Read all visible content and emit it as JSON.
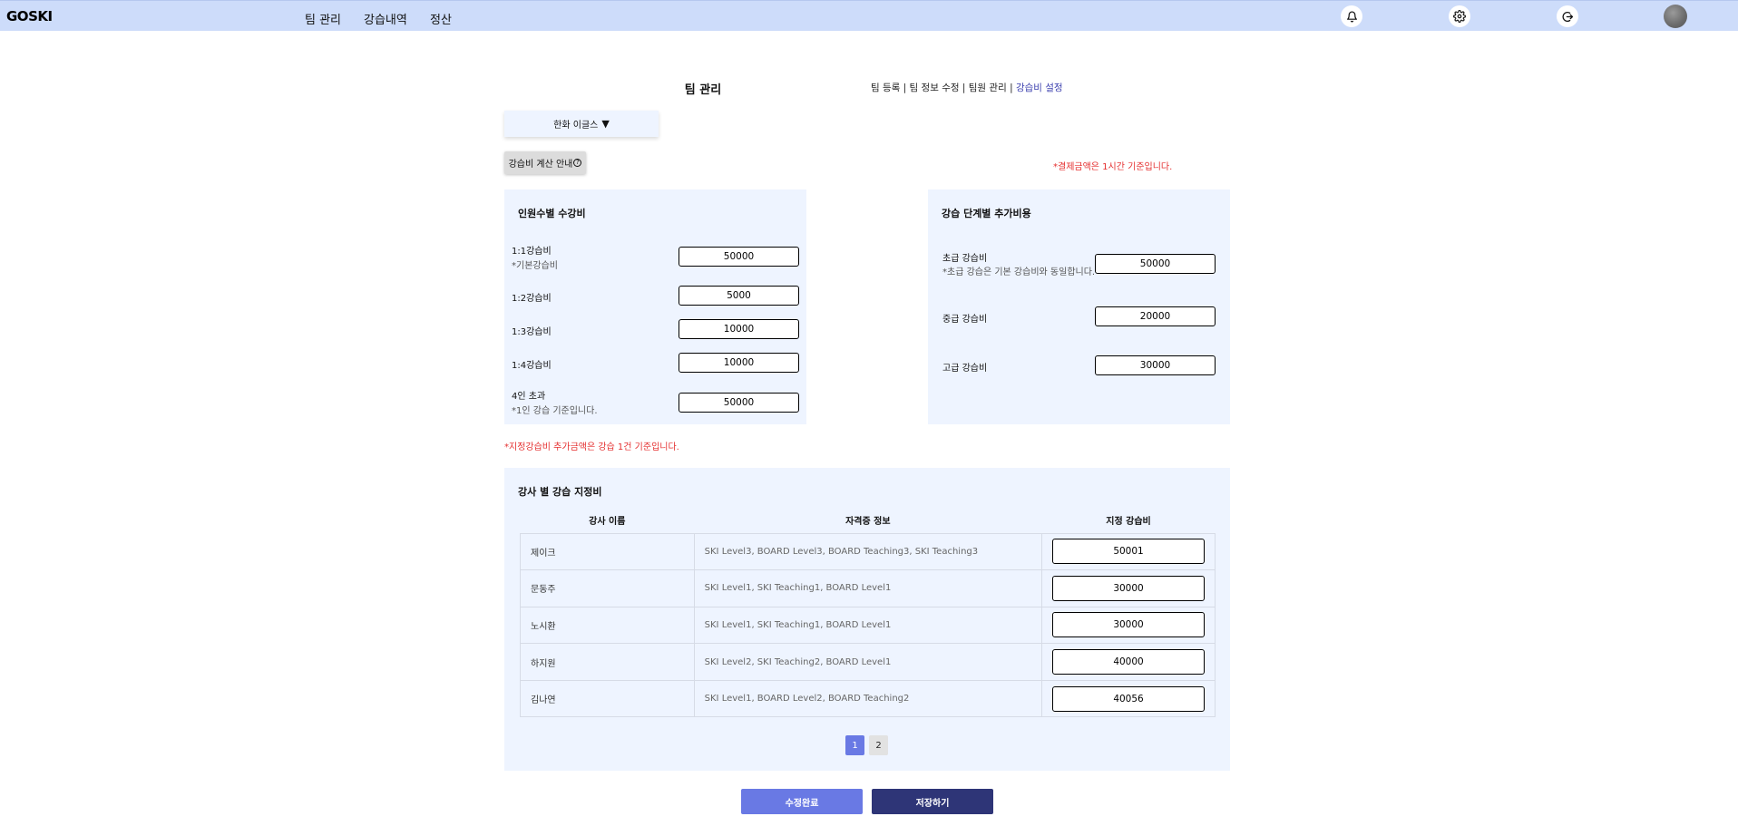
{
  "header": {
    "logo": "GOSKI",
    "nav": [
      "팀 관리",
      "강습내역",
      "정산"
    ],
    "icons": [
      "bell-icon",
      "gear-icon",
      "logout-icon"
    ]
  },
  "page": {
    "title": "팀 관리",
    "subnav": [
      "팀 등록",
      "팀 정보 수정",
      "팀원 관리",
      "강습비 설정"
    ],
    "subnav_sep": " | ",
    "active_subnav": "강습비 설정"
  },
  "team_select": {
    "label": "한화 이글스",
    "arrow": "▼"
  },
  "calc_guide": {
    "label": "강습비 계산 안내",
    "icon": "?"
  },
  "notes": {
    "payment_basis": "*결제금액은 1시간 기준입니다.",
    "designated_basis": "*지정강습비 추가금액은 강습 1건 기준입니다."
  },
  "per_person": {
    "title": "인원수별 수강비",
    "rows": [
      {
        "label": "1:1강습비",
        "sub": "*기본강습비",
        "value": "50000"
      },
      {
        "label": "1:2강습비",
        "sub": "",
        "value": "5000"
      },
      {
        "label": "1:3강습비",
        "sub": "",
        "value": "10000"
      },
      {
        "label": "1:4강습비",
        "sub": "",
        "value": "10000"
      },
      {
        "label": "4인 초과",
        "sub": "*1인 강습 기준입니다.",
        "value": "50000"
      }
    ]
  },
  "level_fee": {
    "title": "강습 단계별 추가비용",
    "rows": [
      {
        "label": "초급 강습비",
        "sub": "*초급 강습은 기본 강습비와 동일합니다.",
        "value": "50000"
      },
      {
        "label": "중급 강습비",
        "sub": "",
        "value": "20000"
      },
      {
        "label": "고급 강습비",
        "sub": "",
        "value": "30000"
      }
    ]
  },
  "instructor_fee": {
    "title": "강사 별 강습 지정비",
    "columns": [
      "강사 이름",
      "자격증 정보",
      "지정 강습비"
    ],
    "rows": [
      {
        "name": "제이크",
        "cert": "SKI Level3, BOARD Level3, BOARD Teaching3, SKI Teaching3",
        "fee": "50001"
      },
      {
        "name": "문동주",
        "cert": "SKI Level1, SKI Teaching1, BOARD Level1",
        "fee": "30000"
      },
      {
        "name": "노시환",
        "cert": "SKI Level1, SKI Teaching1, BOARD Level1",
        "fee": "30000"
      },
      {
        "name": "하지원",
        "cert": "SKI Level2, SKI Teaching2, BOARD Level1",
        "fee": "40000"
      },
      {
        "name": "김나연",
        "cert": "SKI Level1, BOARD Level2, BOARD Teaching2",
        "fee": "40056"
      }
    ]
  },
  "pagination": {
    "pages": [
      "1",
      "2"
    ],
    "current": "1"
  },
  "buttons": {
    "edit_done": "수정완료",
    "save": "저장하기"
  },
  "colors": {
    "header_bg": "#cddcfa",
    "panel_bg": "#eef4ff",
    "edit_button": "#6979e4",
    "save_button": "#2e3577",
    "note_red": "#e53030",
    "active_link": "#3b3fae"
  }
}
